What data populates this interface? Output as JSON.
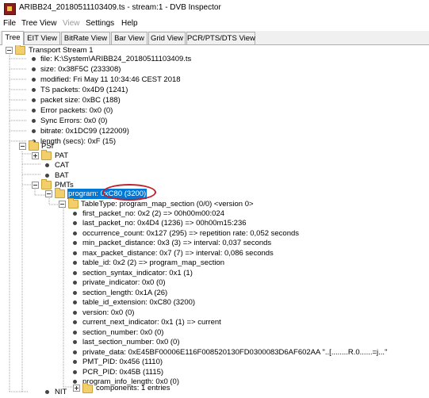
{
  "window": {
    "title": "ARIBB24_20180511103409.ts - stream:1 - DVB Inspector"
  },
  "menu": {
    "file": "File",
    "tree_view": "Tree View",
    "view": "View",
    "settings": "Settings",
    "help": "Help"
  },
  "tabs": [
    "Tree",
    "EIT View",
    "BitRate View",
    "Bar View",
    "Grid View",
    "PCR/PTS/DTS View"
  ],
  "tree": {
    "root": "Transport Stream 1",
    "stream_info": [
      "file: K:\\System\\ARIBB24_20180511103409.ts",
      "size: 0x38F5C (233308)",
      "modified: Fri May 11 10:34:46 CEST 2018",
      "TS packets: 0x4D9 (1241)",
      "packet size: 0xBC (188)",
      "Error packets: 0x0 (0)",
      "Sync Errors: 0x0 (0)",
      "bitrate: 0x1DC99 (122009)",
      "length (secs): 0xF (15)"
    ],
    "psi": "PSI",
    "pat": "PAT",
    "cat": "CAT",
    "bat": "BAT",
    "pmts": "PMTs",
    "program": "program: 0xC80 (3200)",
    "table_type": "TableType: program_map_section (0/0) <version 0>",
    "fields": [
      "first_packet_no: 0x2 (2) => 00h00m00:024",
      "last_packet_no: 0x4D4 (1236) => 00h00m15:236",
      "occurrence_count: 0x127 (295) => repetition rate: 0,052 seconds",
      "min_packet_distance: 0x3 (3) => interval: 0,037 seconds",
      "max_packet_distance: 0x7 (7) => interval: 0,086 seconds",
      "table_id: 0x2 (2) => program_map_section",
      "section_syntax_indicator: 0x1 (1)",
      "private_indicator: 0x0 (0)",
      "section_length: 0x1A (26)",
      "table_id_extension: 0xC80 (3200)",
      "version: 0x0 (0)",
      "current_next_indicator: 0x1 (1) => current",
      "section_number: 0x0 (0)",
      "last_section_number: 0x0 (0)",
      "private_data: 0xE45BF00006E116F008520130FD0300083D6AF602AA \"..[........R.0......=j...\"",
      "PMT_PID: 0x456 (1110)",
      "PCR_PID: 0x45B (1115)",
      "program_info_length: 0x0 (0)"
    ],
    "components": "components: 1 entries",
    "nit": "NIT"
  },
  "colors": {
    "selection": "#0078d7",
    "highlight_circle": "#c0202a",
    "folder": "#f2cf6a"
  }
}
